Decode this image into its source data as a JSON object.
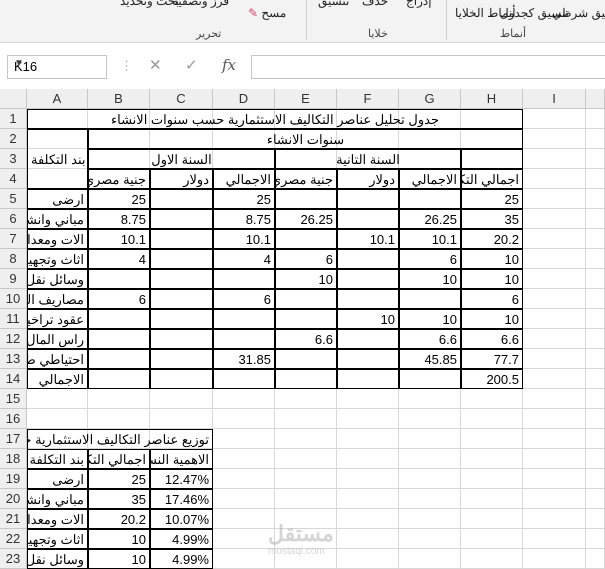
{
  "ribbon": {
    "items": [
      "تنسيق",
      "تنسيق",
      "نمط",
      "إدراج",
      "حذف",
      "تنسيق",
      "فرز",
      "بحث",
      "مسح",
      "وتحديد",
      "وتصفية",
      "كجدول",
      "الخلايا",
      "شرطي"
    ],
    "groups": {
      "editing": "تحرير",
      "cells": "خلايا",
      "styles": "أنماط"
    },
    "clear_label": "مسح",
    "sort_label": "فرز وتصفية",
    "find_label": "بحث وتحديد",
    "format_table": "تنسيق كجدول",
    "cell_styles": "أنماط الخلايا",
    "cond_format": "تنسيق شرطي"
  },
  "formula_bar": {
    "name_box": "K16",
    "fx": "fx",
    "cancel": "✕",
    "enter": "✓",
    "formula": ""
  },
  "columns": [
    "A",
    "B",
    "C",
    "D",
    "E",
    "F",
    "G",
    "H",
    "I"
  ],
  "rows": [
    "1",
    "2",
    "3",
    "4",
    "5",
    "6",
    "7",
    "8",
    "9",
    "10",
    "11",
    "12",
    "13",
    "14",
    "15",
    "16",
    "17",
    "18",
    "19",
    "20",
    "21",
    "22",
    "23"
  ],
  "sheet": {
    "title": "جدول تحليل عناصر التكاليف الاستثمارية حسب سنوات الانشاء",
    "years_header": "سنوات الانشاء",
    "item_header": "بند التكلفة",
    "year1": "السنة الاول",
    "year2": "السنة التانية",
    "sub": {
      "egp": "جنية مصري",
      "usd": "دولار",
      "total": "الاجمالي",
      "grand": "اجمالي التكلفة"
    },
    "items": [
      "ارضى",
      "مباني وانشاءات",
      "الات ومعدات",
      "اثاث وتجهيزات",
      "وسائل نقل",
      "مصاريف التأسيس",
      "عقود تراخيص",
      "راس المال العامل",
      "احتياطي طوارئ",
      "الاجمالي"
    ],
    "B": [
      "25",
      "8.75",
      "10.1",
      "4",
      "",
      "6",
      "",
      "",
      "",
      ""
    ],
    "D": [
      "25",
      "8.75",
      "10.1",
      "4",
      "",
      "6",
      "",
      "",
      "31.85",
      ""
    ],
    "E": [
      "",
      "26.25",
      "",
      "6",
      "10",
      "",
      "",
      "6.6",
      "",
      ""
    ],
    "F": [
      "",
      "",
      "10.1",
      "",
      "",
      "",
      "10",
      "",
      "",
      ""
    ],
    "G": [
      "",
      "26.25",
      "10.1",
      "6",
      "10",
      "",
      "10",
      "6.6",
      "45.85",
      ""
    ],
    "H": [
      "25",
      "35",
      "20.2",
      "10",
      "10",
      "6",
      "10",
      "6.6",
      "77.7",
      "200.5"
    ]
  },
  "table2": {
    "title": "توزيع عناصر التكاليف الاستثمارية حسب",
    "col_item": "بند التكلفة",
    "col_total": "اجمالي التكلفة",
    "col_share": "الاهمية النسبية",
    "items": [
      "ارضى",
      "مباني وانشاءات",
      "الات ومعدات",
      "اثاث وتجهيزات",
      "وسائل نقل"
    ],
    "totals": [
      "25",
      "35",
      "20.2",
      "10",
      "10"
    ],
    "shares": [
      "12.47%",
      "17.46%",
      "10.07%",
      "4.99%",
      "4.99%"
    ]
  },
  "watermark": {
    "name": "مستقل",
    "url": "mostaql.com"
  }
}
